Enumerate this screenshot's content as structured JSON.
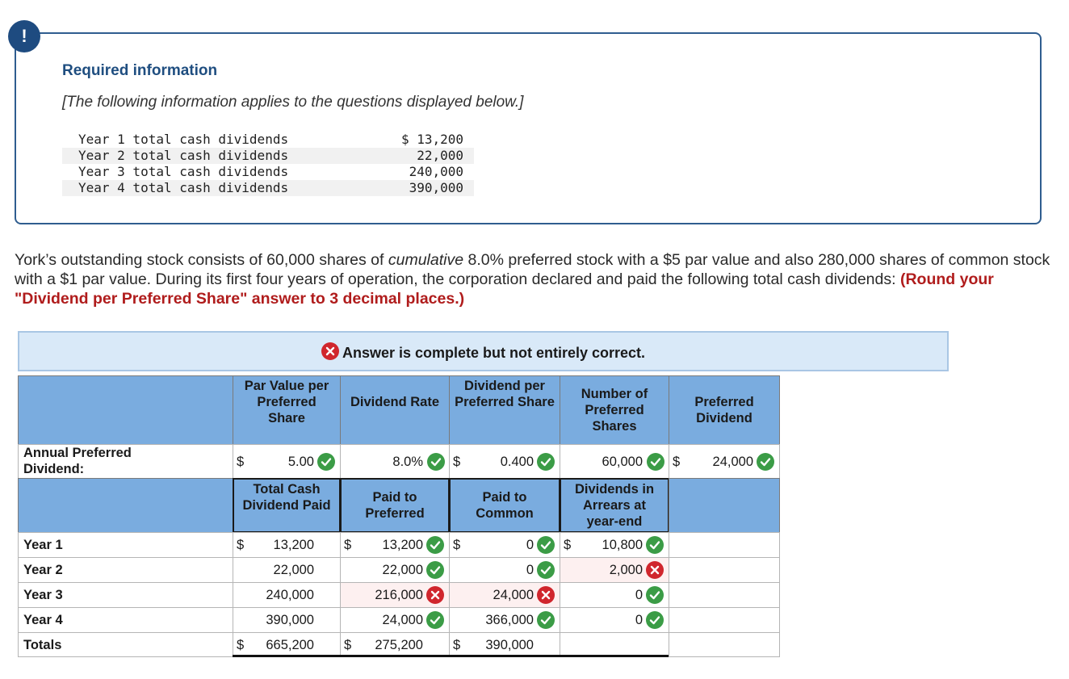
{
  "alert": {
    "icon": "!"
  },
  "required": {
    "title": "Required information",
    "subtitle": "[The following information applies to the questions displayed below.]",
    "rows": [
      {
        "label": "Year 1 total cash dividends",
        "amount": "$ 13,200"
      },
      {
        "label": "Year 2 total cash dividends",
        "amount": "22,000"
      },
      {
        "label": "Year 3 total cash dividends",
        "amount": "240,000"
      },
      {
        "label": "Year 4 total cash dividends",
        "amount": "390,000"
      }
    ]
  },
  "problem": {
    "text_1": "York’s outstanding stock consists of 60,000 shares of ",
    "text_italic": "cumulative",
    "text_2": " 8.0% preferred stock with a $5 par value and also 280,000 shares of common stock with a $1 par value. During its first four years of operation, the corporation declared and paid the following total cash dividends: ",
    "instruction": "(Round your \"Dividend per Preferred Share\" answer to 3 decimal places.)"
  },
  "banner": {
    "text": "Answer is complete but not entirely correct."
  },
  "colors": {
    "header_bg": "#7aacdf",
    "correct": "#3b9c46",
    "incorrect": "#d0262d",
    "banner_bg": "#d9e9f8"
  },
  "grid": {
    "header1": {
      "par_value": "Par Value per Preferred Share",
      "dividend_rate": "Dividend Rate",
      "dividend_per_share": "Dividend per Preferred Share",
      "num_shares": "Number of Preferred Shares",
      "preferred_dividend": "Preferred Dividend"
    },
    "annual": {
      "label": "Annual Preferred Dividend:",
      "dollar": "$",
      "par_value": "5.00",
      "dividend_rate": "8.0%",
      "dividend_per_share": "0.400",
      "num_shares": "60,000",
      "preferred_dividend": "24,000"
    },
    "header2": {
      "total_cash": "Total Cash Dividend Paid",
      "paid_preferred": "Paid to Preferred",
      "paid_common": "Paid to Common",
      "arrears": "Dividends in Arrears at year-end"
    },
    "years": [
      {
        "label": "Year 1",
        "total": "13,200",
        "preferred": "13,200",
        "preferred_status": "correct",
        "common": "0",
        "common_status": "correct",
        "arrears": "10,800",
        "arrears_status": "correct"
      },
      {
        "label": "Year 2",
        "total": "22,000",
        "preferred": "22,000",
        "preferred_status": "correct",
        "common": "0",
        "common_status": "correct",
        "arrears": "2,000",
        "arrears_status": "incorrect"
      },
      {
        "label": "Year 3",
        "total": "240,000",
        "preferred": "216,000",
        "preferred_status": "incorrect",
        "common": "24,000",
        "common_status": "incorrect",
        "arrears": "0",
        "arrears_status": "correct"
      },
      {
        "label": "Year 4",
        "total": "390,000",
        "preferred": "24,000",
        "preferred_status": "correct",
        "common": "366,000",
        "common_status": "correct",
        "arrears": "0",
        "arrears_status": "correct"
      }
    ],
    "totals": {
      "label": "Totals",
      "total": "665,200",
      "preferred": "275,200",
      "common": "390,000"
    }
  }
}
